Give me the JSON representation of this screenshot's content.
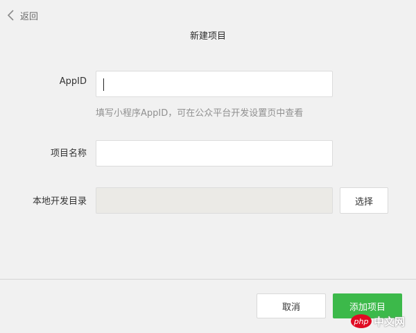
{
  "header": {
    "back_label": "返回",
    "title": "新建项目",
    "back_icon": "chevron-left-icon"
  },
  "form": {
    "appid": {
      "label": "AppID",
      "value": "",
      "hint": "填写小程序AppID，可在公众平台开发设置页中查看"
    },
    "project_name": {
      "label": "项目名称",
      "value": ""
    },
    "local_dir": {
      "label": "本地开发目录",
      "value": "",
      "select_label": "选择"
    }
  },
  "footer": {
    "cancel_label": "取消",
    "add_label": "添加项目"
  },
  "watermark": {
    "php": "php",
    "site": "中文网"
  },
  "colors": {
    "background": "#f1f1f1",
    "primary_button": "#3cb94a",
    "disabled_input": "#ebeae6",
    "hint_text": "#909090"
  }
}
